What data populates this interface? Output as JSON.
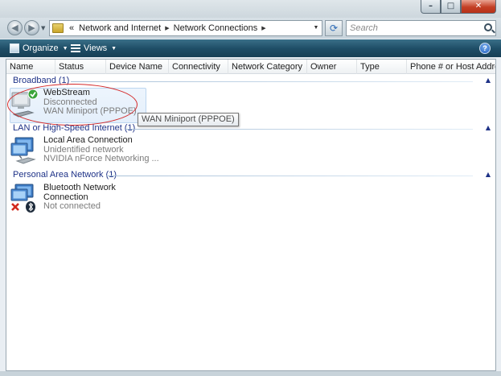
{
  "window": {
    "caption_minimize": "–",
    "caption_maximize": "□",
    "caption_close": "✕"
  },
  "nav": {
    "back_glyph": "◀",
    "forward_glyph": "▶",
    "dropdown_glyph": "▼"
  },
  "address": {
    "prefix": "«",
    "segments": [
      "Network and Internet",
      "Network Connections"
    ],
    "separator": "▶"
  },
  "search": {
    "placeholder": "Search"
  },
  "command_bar": {
    "organize": "Organize",
    "views": "Views",
    "caret": "▼",
    "help": "?"
  },
  "columns": [
    "Name",
    "Status",
    "Device Name",
    "Connectivity",
    "Network Category",
    "Owner",
    "Type",
    "Phone # or Host Addre..."
  ],
  "groups": [
    {
      "header": "Broadband (1)",
      "items": [
        {
          "name": "WebStream",
          "status": "Disconnected",
          "device": "WAN Miniport (PPPOE)"
        }
      ]
    },
    {
      "header": "LAN or High-Speed Internet (1)",
      "items": [
        {
          "name": "Local Area Connection",
          "status": "Unidentified network",
          "device": "NVIDIA nForce Networking ..."
        }
      ]
    },
    {
      "header": "Personal Area Network (1)",
      "items": [
        {
          "name_line1": "Bluetooth Network",
          "name_line2": "Connection",
          "status": "Not connected"
        }
      ]
    }
  ],
  "tooltip": "WAN Miniport (PPPOE)",
  "collapse_glyph": "▲",
  "colors": {
    "group_header": "#1e3287",
    "command_bar": "#1f4e67",
    "annotation": "#d42a2a"
  }
}
